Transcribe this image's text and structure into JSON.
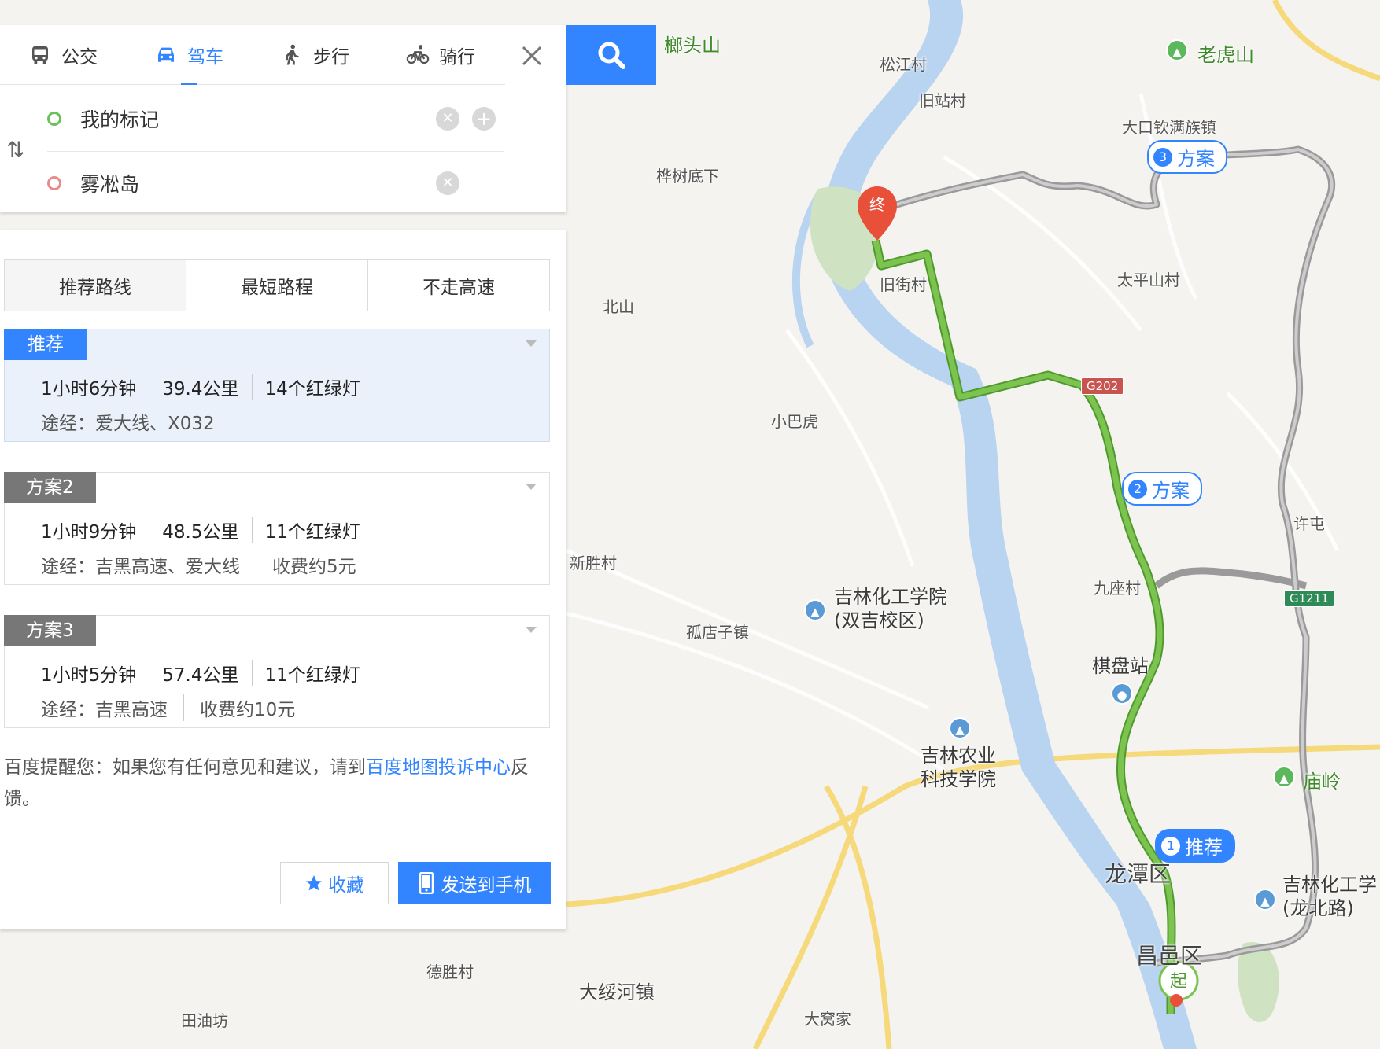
{
  "modes": [
    {
      "label": "公交",
      "icon": "bus-icon"
    },
    {
      "label": "驾车",
      "icon": "car-icon"
    },
    {
      "label": "步行",
      "icon": "walk-icon"
    },
    {
      "label": "骑行",
      "icon": "bike-icon"
    }
  ],
  "active_mode": "驾车",
  "start": {
    "value": "我的标记"
  },
  "end": {
    "value": "雾凇岛"
  },
  "route_tabs": [
    "推荐路线",
    "最短路程",
    "不走高速"
  ],
  "active_route_tab": "推荐路线",
  "plans": [
    {
      "tag": "推荐",
      "time": "1小时6分钟",
      "distance": "39.4公里",
      "lights": "14个红绿灯",
      "via": "途经：爱大线、X032",
      "fee": ""
    },
    {
      "tag": "方案2",
      "time": "1小时9分钟",
      "distance": "48.5公里",
      "lights": "11个红绿灯",
      "via": "途经：吉黑高速、爱大线",
      "fee": "收费约5元"
    },
    {
      "tag": "方案3",
      "time": "1小时5分钟",
      "distance": "57.4公里",
      "lights": "11个红绿灯",
      "via": "途经：吉黑高速",
      "fee": "收费约10元"
    }
  ],
  "notice": {
    "prefix": "百度提醒您：如果您有任何意见和建议，请到",
    "link": "百度地图投诉中心",
    "suffix": "反馈。"
  },
  "buttons": {
    "favorite": "收藏",
    "send": "发送到手机"
  },
  "map": {
    "labels": [
      "松江村",
      "旧站村",
      "桦树底下",
      "北山",
      "旧街村",
      "太平山村",
      "小巴虎",
      "新胜村",
      "孤店子镇",
      "九座村",
      "许屯",
      "德胜村",
      "大绥河镇",
      "田油坊",
      "大窝家",
      "大口钦满族镇"
    ],
    "green_labels": [
      "榔头山",
      "老虎山",
      "庙岭"
    ],
    "districts": [
      "龙潭区",
      "昌邑区"
    ],
    "pois": [
      {
        "name": "吉林化工学院\n(双吉校区)"
      },
      {
        "name": "吉林农业\n科技学院"
      },
      {
        "name": "棋盘站"
      },
      {
        "name": "吉林化工学\n(龙北路)"
      }
    ],
    "shields": [
      "G202",
      "G1211"
    ],
    "route_tags": [
      {
        "num": "1",
        "label": "推荐"
      },
      {
        "num": "2",
        "label": "方案"
      },
      {
        "num": "3",
        "label": "方案"
      }
    ],
    "markers": {
      "start": "起",
      "end": "终"
    },
    "colors": {
      "route_selected": "#6ab547",
      "route_other": "#9a9a9a",
      "accent": "#3385ff",
      "river": "#b8d4f0"
    }
  }
}
